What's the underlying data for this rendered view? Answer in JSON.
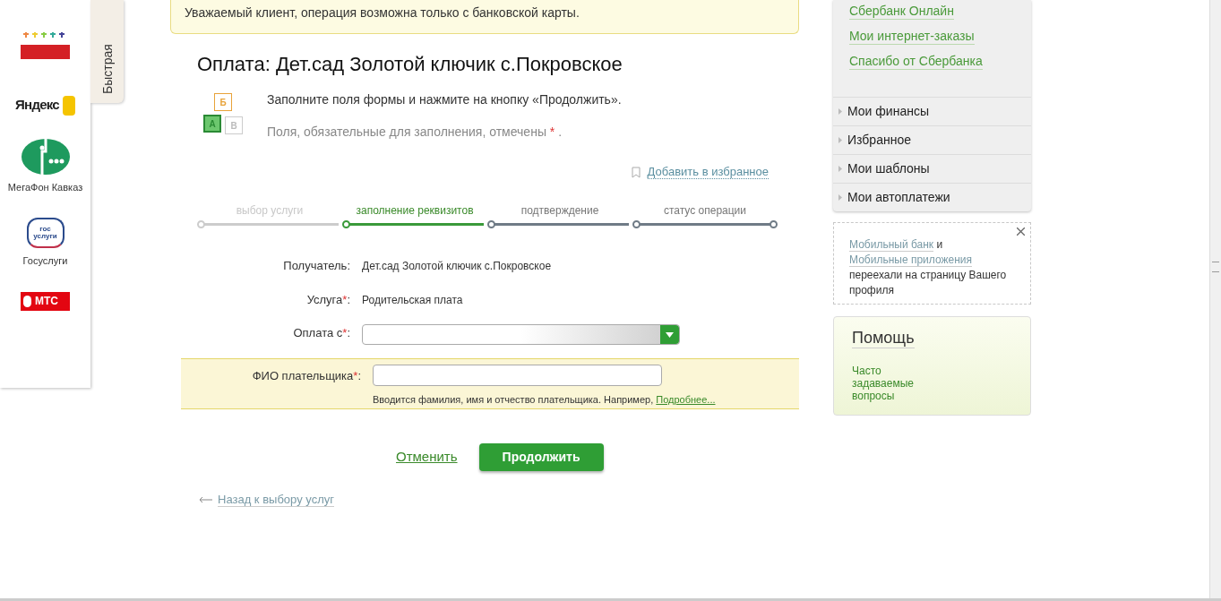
{
  "partners": [
    {
      "kind": "kids"
    },
    {
      "kind": "yandex",
      "logo_text": "Яндекс"
    },
    {
      "kind": "megafon",
      "caption": "МегаФон Кавказ"
    },
    {
      "kind": "gosuslugi",
      "logo_text": "гос услуги",
      "caption": "Госуслуги"
    },
    {
      "kind": "mts",
      "logo_text": "МТС"
    }
  ],
  "quick_tab": {
    "label": "Быстрая"
  },
  "alert": "Уважаемый клиент, операция возможна только с банковской карты.",
  "title": "Оплата: Дет.сад Золотой ключик с.Покровское",
  "instructions": {
    "blocks": [
      "Б",
      "А",
      "В"
    ],
    "line1": "Заполните поля формы и нажмите на кнопку «Продолжить».",
    "line2": "Поля, обязательные для заполнения, отмечены",
    "required_mark": "*",
    "line2_end": "."
  },
  "favorite_link": "Добавить в избранное",
  "steps": [
    {
      "label": "выбор услуги",
      "kind": "done"
    },
    {
      "label": "заполнение реквизитов",
      "kind": "current"
    },
    {
      "label": "подтверждение",
      "kind": "upcoming"
    },
    {
      "label": "статус операции",
      "kind": "upcoming"
    }
  ],
  "fields": [
    {
      "kind": "text",
      "label": "Получатель:",
      "required": false,
      "value": "Дет.сад Золотой ключик с.Покровское"
    },
    {
      "kind": "text",
      "label": "Услуга",
      "required": true,
      "label_end": ":",
      "value": "Родительская плата"
    },
    {
      "kind": "select",
      "label": "Оплата с",
      "required": true,
      "label_end": ":"
    },
    {
      "kind": "input",
      "label": "ФИО плательщика",
      "required": true,
      "label_end": ":",
      "hint": "Вводится фамилия, имя и отчество плательщика. Например,",
      "hint_link": "Подробнее..."
    }
  ],
  "cancel": "Отменить",
  "continue": "Продолжить",
  "back_link": "Назад к выбору услуг",
  "right_links": [
    "Сбербанк Онлайн",
    "Мои интернет-заказы",
    "Спасибо от Сбербанка"
  ],
  "menu": [
    "Мои финансы",
    "Избранное",
    "Мои шаблоны",
    "Мои автоплатежи"
  ],
  "notice": {
    "link1": "Мобильный банк",
    "and": "и",
    "link2": "Мобильные приложения",
    "rest": "переехали на страницу Вашего профиля"
  },
  "help": {
    "title": "Помощь",
    "link": "Часто задаваемые вопросы"
  }
}
